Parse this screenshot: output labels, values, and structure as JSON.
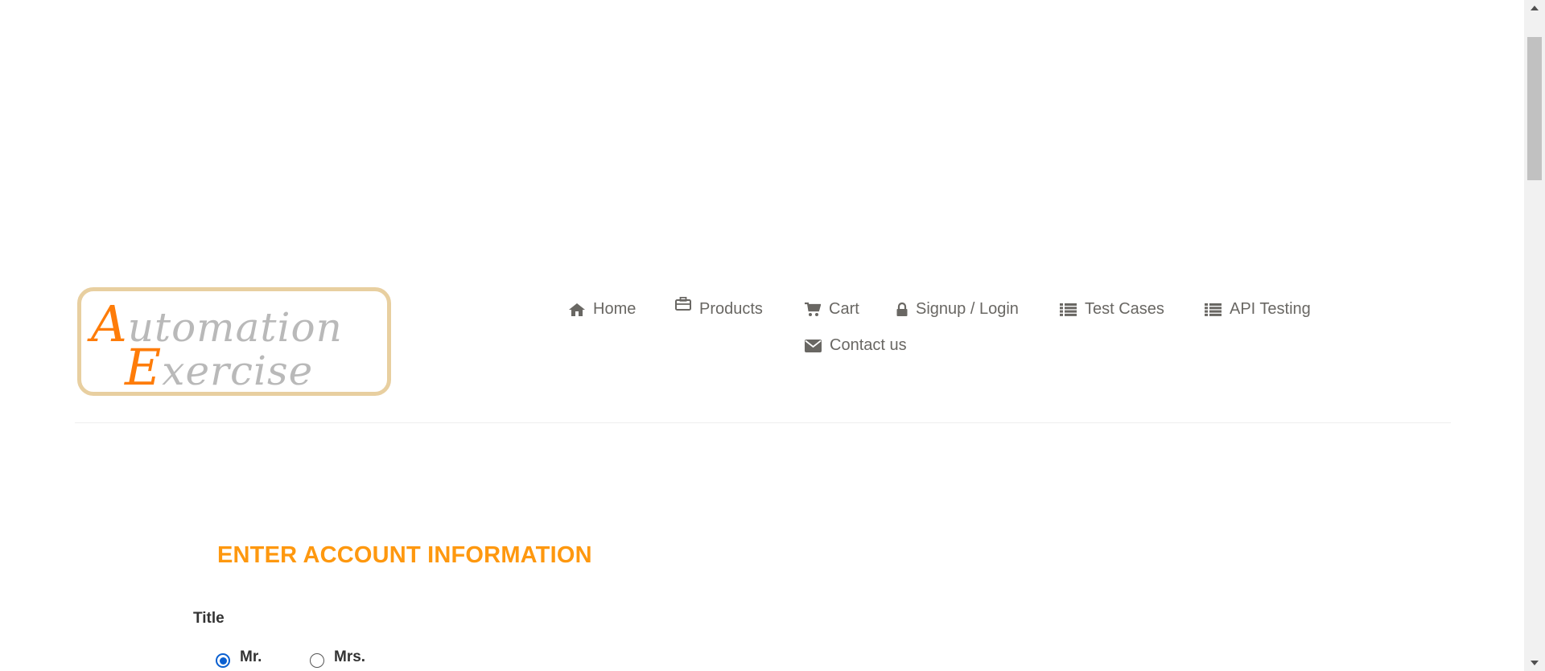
{
  "logo": {
    "line1_cap": "A",
    "line1_rest": "utomation",
    "line2_cap": "E",
    "line2_rest": "xercise"
  },
  "nav": {
    "items": [
      {
        "label": "Home",
        "icon": "home-icon"
      },
      {
        "label": "Products",
        "icon": "briefcase-icon"
      },
      {
        "label": "Cart",
        "icon": "cart-icon"
      },
      {
        "label": "Signup / Login",
        "icon": "lock-icon"
      },
      {
        "label": "Test Cases",
        "icon": "list-icon"
      },
      {
        "label": "API Testing",
        "icon": "list-icon"
      },
      {
        "label": "Contact us",
        "icon": "envelope-icon"
      }
    ]
  },
  "form": {
    "heading": "ENTER ACCOUNT INFORMATION",
    "title_label": "Title",
    "title_options": [
      {
        "label": "Mr.",
        "checked": true
      },
      {
        "label": "Mrs.",
        "checked": false
      }
    ]
  },
  "colors": {
    "accent": "#fe980f",
    "logo_orange": "#fe7c09",
    "nav_text": "#696763",
    "radio_checked": "#0a5fd0"
  }
}
